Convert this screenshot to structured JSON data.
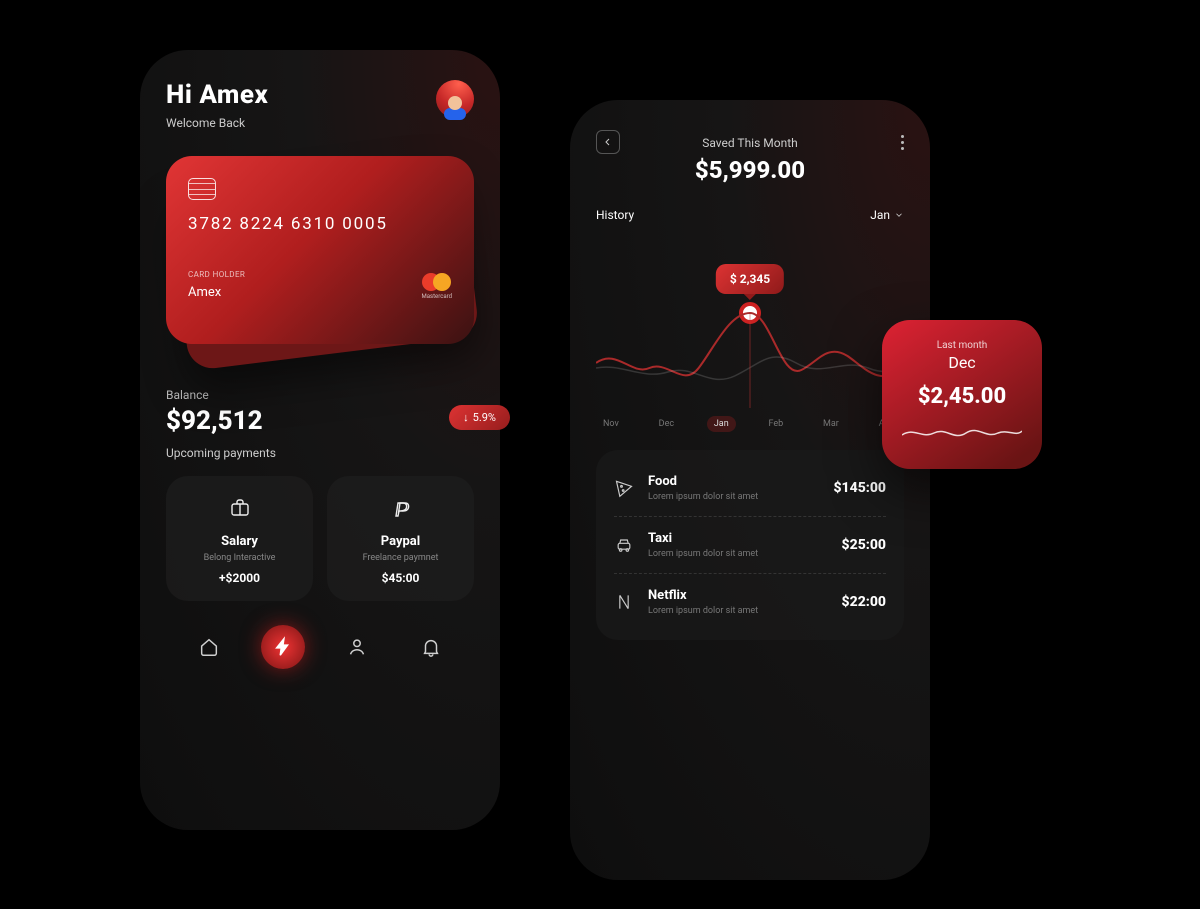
{
  "left": {
    "greeting": "Hi Amex",
    "welcome": "Welcome Back",
    "card": {
      "number": "3782 8224 6310 0005",
      "holder_label": "CARD HOLDER",
      "holder": "Amex",
      "network_label": "Mastercard"
    },
    "balance_label": "Balance",
    "balance": "$92,512",
    "change": "5.9%",
    "upcoming_label": "Upcoming payments",
    "tiles": [
      {
        "title": "Salary",
        "sub": "Belong Interactive",
        "amount": "+$2000"
      },
      {
        "title": "Paypal",
        "sub": "Freelance paymnet",
        "amount": "$45:00"
      }
    ]
  },
  "right": {
    "saved_label": "Saved This Month",
    "saved_amount": "$5,999.00",
    "history_label": "History",
    "tooltip_value": "$ 2,345",
    "month_selected": "Jan",
    "months": [
      "Nov",
      "Dec",
      "Jan",
      "Feb",
      "Mar",
      "April"
    ],
    "transactions": [
      {
        "title": "Food",
        "sub": "Lorem ipsum dolor sit amet",
        "amount": "$145:00"
      },
      {
        "title": "Taxi",
        "sub": "Lorem ipsum dolor sit amet",
        "amount": "$25:00"
      },
      {
        "title": "Netflix",
        "sub": "Lorem ipsum dolor sit amet",
        "amount": "$22:00"
      }
    ]
  },
  "last_month": {
    "label": "Last month",
    "month": "Dec",
    "amount": "$2,45.00"
  },
  "chart_data": {
    "type": "line",
    "title": "History",
    "categories": [
      "Nov",
      "Dec",
      "Jan",
      "Feb",
      "Mar",
      "April"
    ],
    "values": [
      1200,
      900,
      2345,
      1100,
      1600,
      1000
    ],
    "highlight": {
      "category": "Jan",
      "value": 2345
    },
    "ylim": [
      0,
      2500
    ]
  }
}
